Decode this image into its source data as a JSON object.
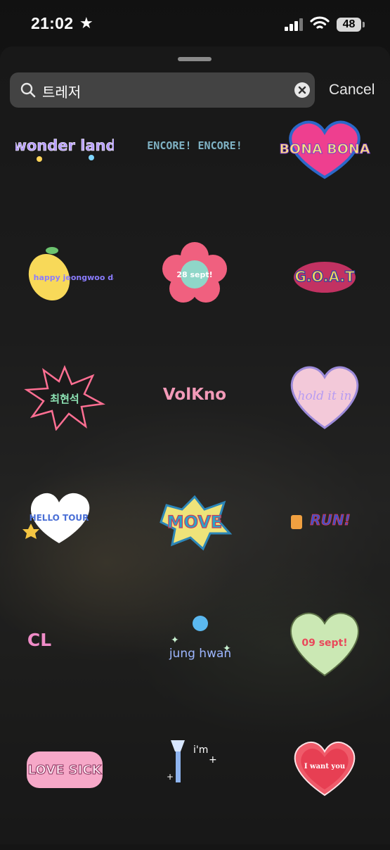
{
  "status_bar": {
    "time": "21:02",
    "battery": "48"
  },
  "search": {
    "query": "트레저",
    "cancel_label": "Cancel"
  },
  "stickers": [
    {
      "id": "wonderland",
      "text": "wonder land"
    },
    {
      "id": "encore",
      "text": "ENCORE! ENCORE!"
    },
    {
      "id": "bona-bona",
      "text": "BONA BONA"
    },
    {
      "id": "happy-jeongwoo-day",
      "text": "happy jeongwoo day!"
    },
    {
      "id": "28-sept",
      "text": "28 sept!"
    },
    {
      "id": "goat",
      "text": "G.O.A.T"
    },
    {
      "id": "choi-hyunsuk",
      "text": "최현석"
    },
    {
      "id": "volkno",
      "text": "VolKno"
    },
    {
      "id": "hold-it-in",
      "text": "hold it in"
    },
    {
      "id": "hello-tour",
      "text": "HELLO TOUR"
    },
    {
      "id": "move",
      "text": "MOVE"
    },
    {
      "id": "run",
      "text": "RUN!"
    },
    {
      "id": "cl",
      "text": "CL"
    },
    {
      "id": "junghwan",
      "text": "jung hwan"
    },
    {
      "id": "09-sept",
      "text": "09 sept!"
    },
    {
      "id": "lovesick",
      "text": "LOVE SICK"
    },
    {
      "id": "im-lightstick",
      "text": "i'm"
    },
    {
      "id": "i-want-you",
      "text": "I want you"
    }
  ],
  "colors": {
    "background": "#151515",
    "search_field": "#5a5a5a",
    "text": "#ffffff"
  }
}
